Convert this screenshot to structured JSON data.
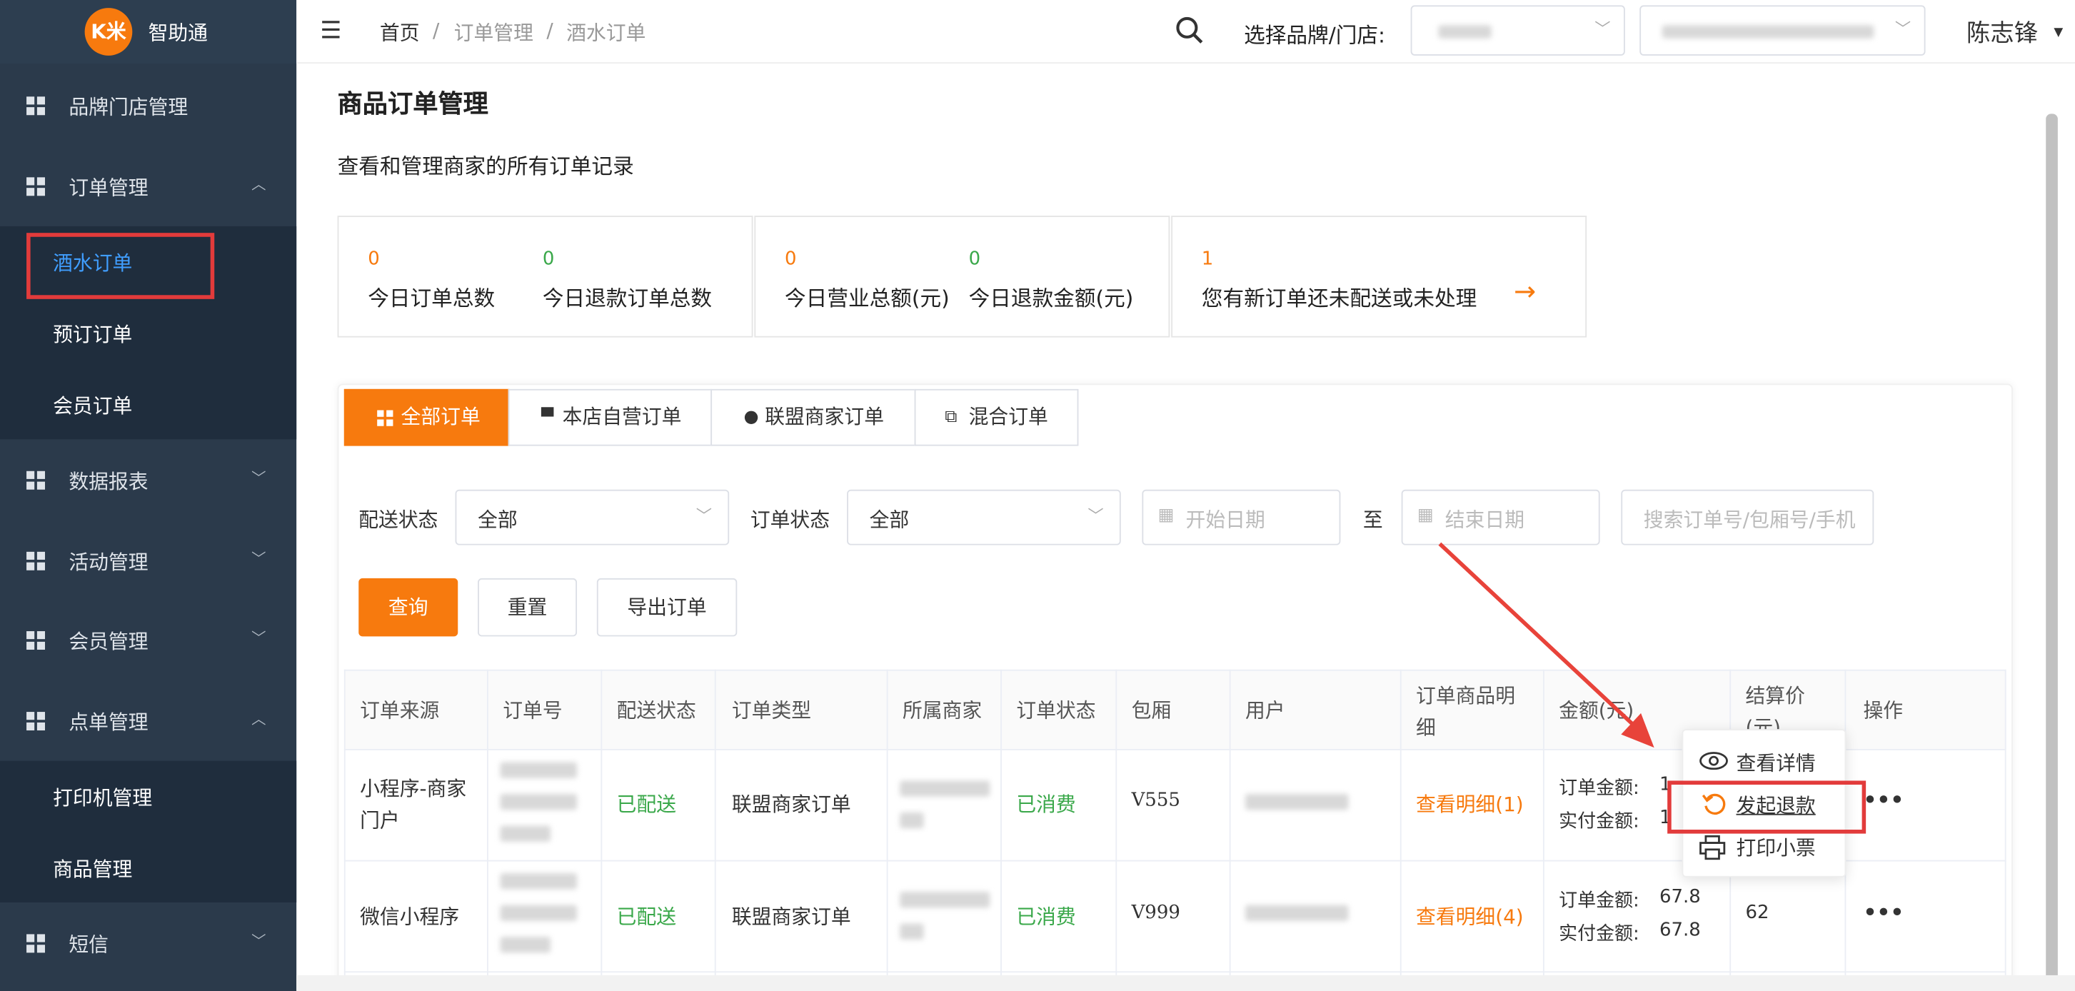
{
  "app": {
    "logo_text": "K米",
    "name": "智助通"
  },
  "sidebar": {
    "groups": [
      {
        "label": "品牌门店管理"
      },
      {
        "label": "订单管理",
        "expanded": true
      },
      {
        "label": "数据报表"
      },
      {
        "label": "活动管理"
      },
      {
        "label": "会员管理"
      },
      {
        "label": "点单管理",
        "expanded": true
      },
      {
        "label": "短信"
      }
    ],
    "order_sub": [
      "酒水订单",
      "预订订单",
      "会员订单"
    ],
    "dish_sub": [
      "打印机管理",
      "商品管理"
    ]
  },
  "topbar": {
    "breadcrumb": [
      "首页",
      "订单管理",
      "酒水订单"
    ],
    "breadcrumb_sep": "/",
    "store_label": "选择品牌/门店:",
    "user_name": "陈志锋"
  },
  "page": {
    "title": "商品订单管理",
    "description": "查看和管理商家的所有订单记录"
  },
  "stats": [
    {
      "value": "0",
      "label": "今日订单总数"
    },
    {
      "value": "0",
      "label": "今日退款订单总数"
    },
    {
      "value": "0",
      "label": "今日营业总额(元)"
    },
    {
      "value": "0",
      "label": "今日退款金额(元)"
    },
    {
      "value": "1",
      "label": "您有新订单还未配送或未处理"
    }
  ],
  "tabs": [
    "全部订单",
    "本店自营订单",
    "联盟商家订单",
    "混合订单"
  ],
  "filters": {
    "delivery_label": "配送状态",
    "delivery_value": "全部",
    "order_status_label": "订单状态",
    "order_status_value": "全部",
    "start_placeholder": "开始日期",
    "to": "至",
    "end_placeholder": "结束日期",
    "search_placeholder": "搜索订单号/包厢号/手机"
  },
  "buttons": {
    "query": "查询",
    "reset": "重置",
    "export": "导出订单"
  },
  "table": {
    "headers": [
      "订单来源",
      "订单号",
      "配送状态",
      "订单类型",
      "所属商家",
      "订单状态",
      "包厢",
      "用户",
      "订单商品明细",
      "金额(元)",
      "结算价(元)",
      "操作"
    ],
    "rows": [
      {
        "source": "小程序-商家门户",
        "delivery": "已配送",
        "type": "联盟商家订单",
        "status": "已消费",
        "room": "V555",
        "detail": "查看明细(1)",
        "amount_label": "订单金额:",
        "amount": "1",
        "paid_label": "实付金额:",
        "paid": "1",
        "settle": "",
        "more": "•••"
      },
      {
        "source": "微信小程序",
        "delivery": "已配送",
        "type": "联盟商家订单",
        "status": "已消费",
        "room": "V999",
        "detail": "查看明细(4)",
        "amount_label": "订单金额:",
        "amount": "67.8",
        "paid_label": "实付金额:",
        "paid": "67.8",
        "settle": "62",
        "more": "•••"
      }
    ]
  },
  "popover": {
    "view": "查看详情",
    "refund": "发起退款",
    "print": "打印小票"
  },
  "colors": {
    "accent": "#f77a0e",
    "sidebar": "#2b3a4b",
    "highlight": "#e23b3b",
    "success": "#3aa84a"
  }
}
